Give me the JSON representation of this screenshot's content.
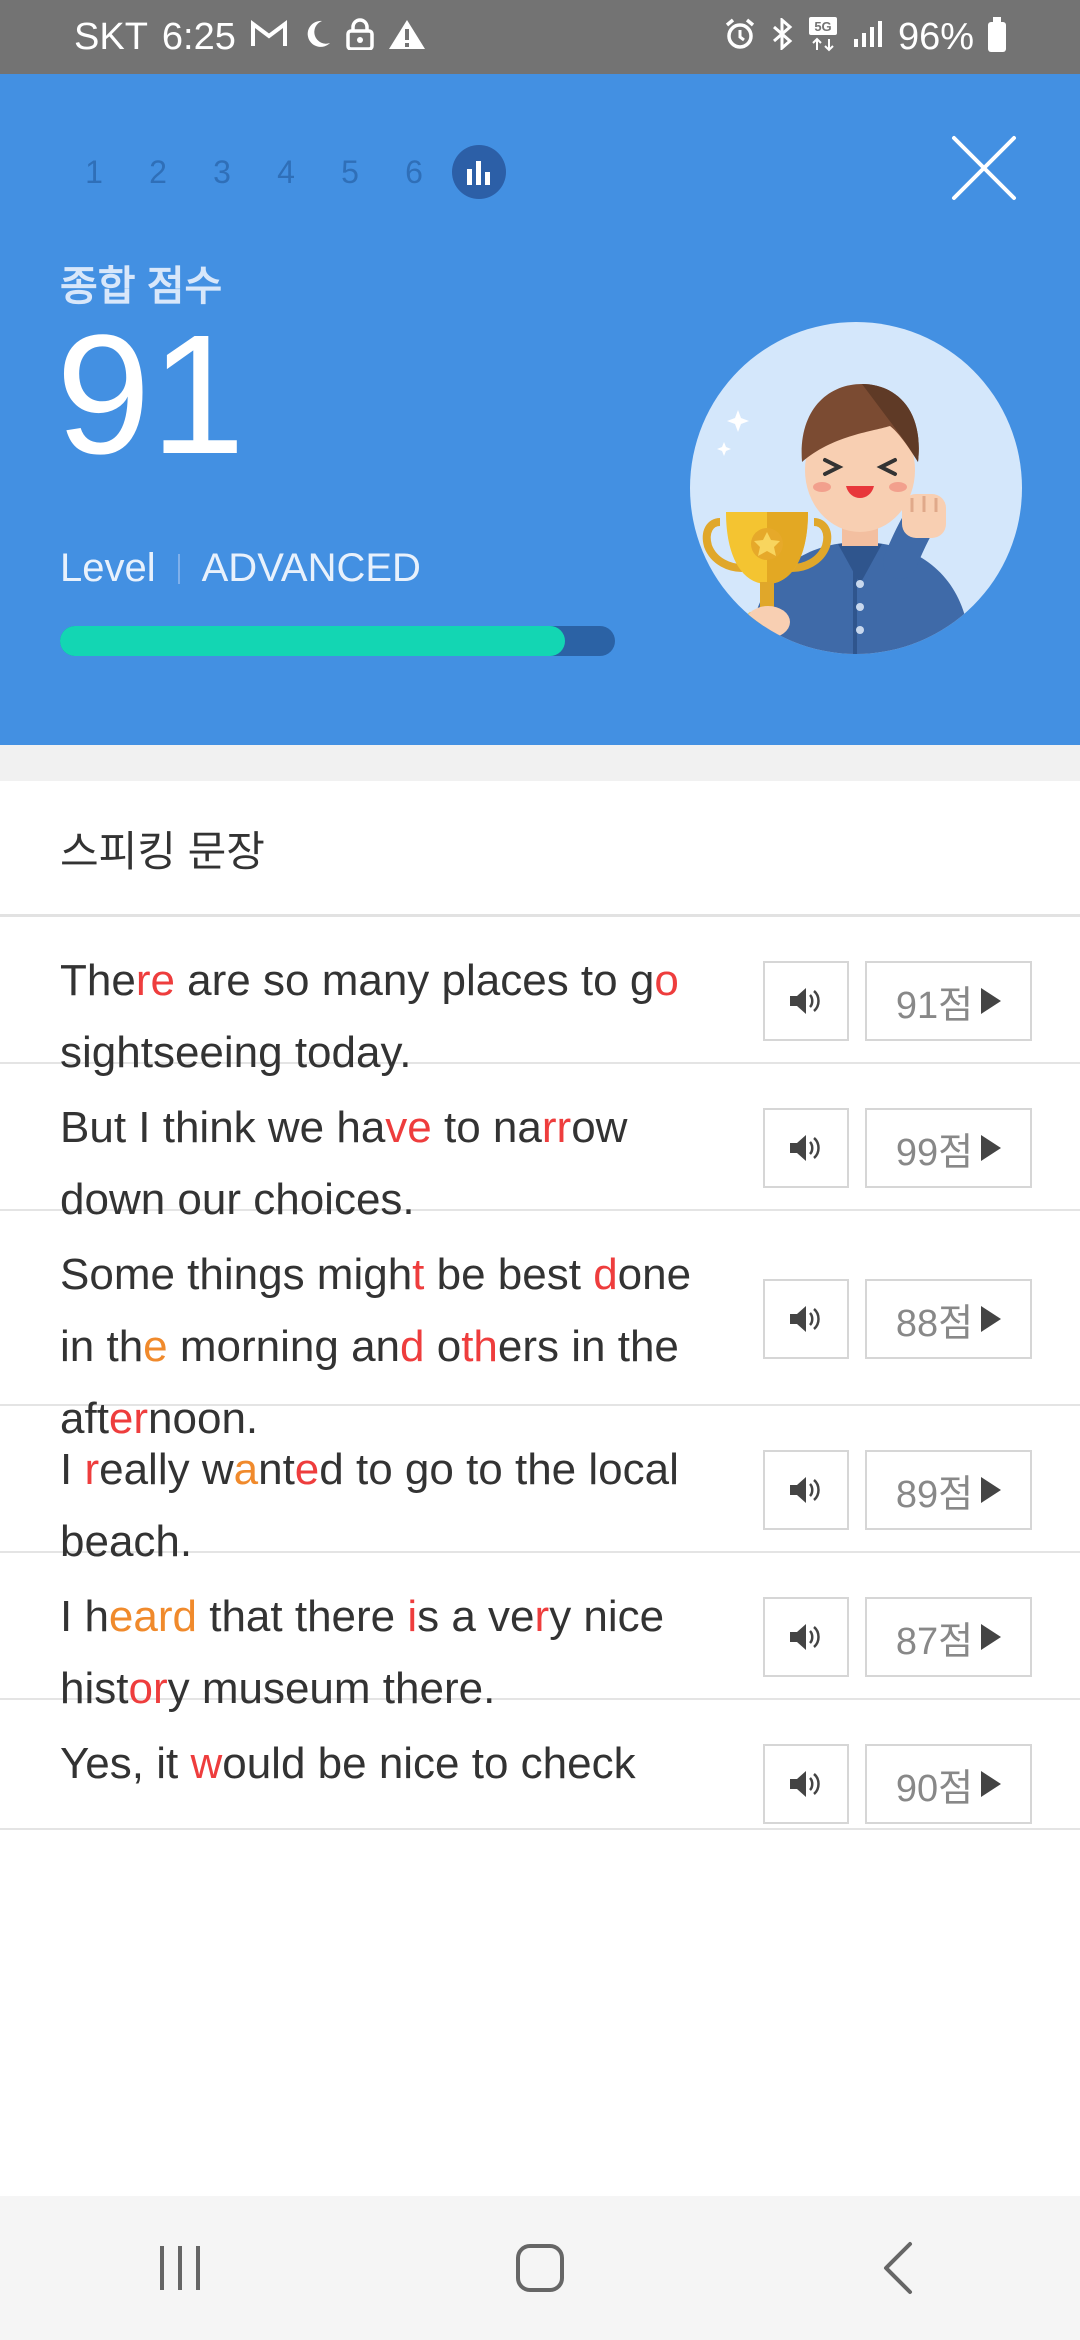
{
  "status_bar": {
    "carrier": "SKT",
    "time": "6:25",
    "battery": "96%",
    "icons_left": [
      "gmail-icon",
      "moon-icon",
      "lock-icon",
      "warning-icon"
    ],
    "icons_right": [
      "alarm-icon",
      "bluetooth-icon",
      "5g-icon",
      "signal-icon",
      "battery-icon"
    ]
  },
  "header": {
    "steps": [
      "1",
      "2",
      "3",
      "4",
      "5",
      "6"
    ],
    "score_label": "종합 점수",
    "score": "91",
    "level_label": "Level",
    "level_value": "ADVANCED",
    "progress": 0.91,
    "colors": {
      "background": "#4390e2",
      "progress_fill": "#13d6b3",
      "progress_track": "#2b62a5"
    }
  },
  "section": {
    "title": "스피킹 문장"
  },
  "sentences": [
    {
      "parts": [
        {
          "t": "The"
        },
        {
          "t": "re",
          "c": "red"
        },
        {
          "t": " are so many places to g"
        },
        {
          "t": "o",
          "c": "red"
        },
        {
          "t": " sightseeing today."
        }
      ],
      "score_label": "91점"
    },
    {
      "parts": [
        {
          "t": "But I think we ha"
        },
        {
          "t": "ve",
          "c": "red"
        },
        {
          "t": " to na"
        },
        {
          "t": "rr",
          "c": "red"
        },
        {
          "t": "ow down our choices."
        }
      ],
      "score_label": "99점"
    },
    {
      "parts": [
        {
          "t": "Some things migh"
        },
        {
          "t": "t",
          "c": "red"
        },
        {
          "t": " be best "
        },
        {
          "t": "d",
          "c": "red"
        },
        {
          "t": "one in th"
        },
        {
          "t": "e",
          "c": "orange"
        },
        {
          "t": " morning an"
        },
        {
          "t": "d",
          "c": "red"
        },
        {
          "t": " o"
        },
        {
          "t": "th",
          "c": "red"
        },
        {
          "t": "ers in the aft"
        },
        {
          "t": "er",
          "c": "red"
        },
        {
          "t": "noon."
        }
      ],
      "score_label": "88점"
    },
    {
      "parts": [
        {
          "t": "I "
        },
        {
          "t": "r",
          "c": "red"
        },
        {
          "t": "eally w"
        },
        {
          "t": "a",
          "c": "orange"
        },
        {
          "t": "nt"
        },
        {
          "t": "e",
          "c": "red"
        },
        {
          "t": "d to go to the local beach."
        }
      ],
      "score_label": "89점"
    },
    {
      "parts": [
        {
          "t": "I h"
        },
        {
          "t": "eard",
          "c": "orange"
        },
        {
          "t": " that there "
        },
        {
          "t": "i",
          "c": "red"
        },
        {
          "t": "s a ve"
        },
        {
          "t": "r",
          "c": "red"
        },
        {
          "t": "y nice hist"
        },
        {
          "t": "or",
          "c": "red"
        },
        {
          "t": "y museum there."
        }
      ],
      "score_label": "87점"
    },
    {
      "parts": [
        {
          "t": "Yes, it "
        },
        {
          "t": "w",
          "c": "red"
        },
        {
          "t": "ould be nice to check"
        }
      ],
      "score_label": "90점"
    }
  ],
  "nav_bar": {
    "buttons": [
      "recent-apps",
      "home",
      "back"
    ]
  }
}
